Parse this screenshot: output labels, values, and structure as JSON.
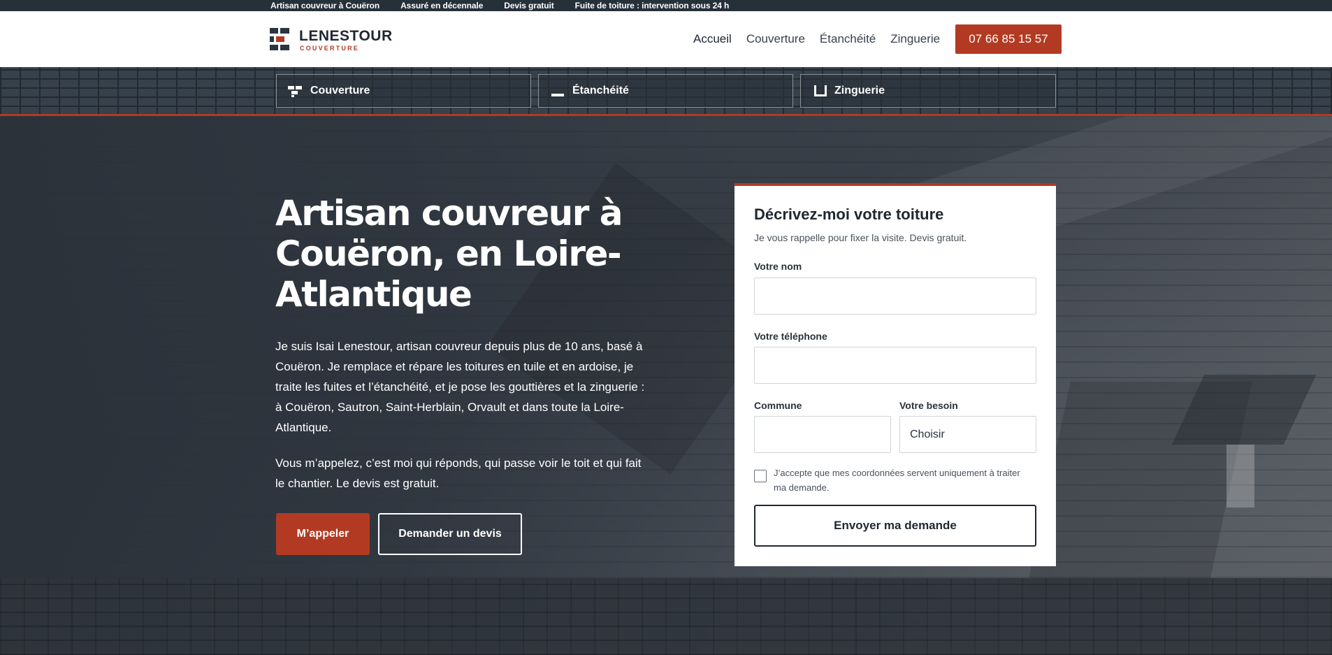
{
  "topbar": {
    "items": [
      "Artisan couvreur à Couëron",
      "Assuré en décennale",
      "Devis gratuit",
      "Fuite de toiture : intervention sous 24 h"
    ]
  },
  "logo": {
    "name": "LENESTOUR",
    "sub": "COUVERTURE"
  },
  "nav": {
    "items": [
      "Accueil",
      "Couverture",
      "Étanchéité",
      "Zinguerie"
    ],
    "phone": "07 66 85 15 57"
  },
  "services": [
    "Couverture",
    "Étanchéité",
    "Zinguerie"
  ],
  "hero": {
    "title": "Artisan couvreur à Couëron, en Loire-Atlantique",
    "p1": "Je suis Isai Lenestour, artisan couvreur depuis plus de 10 ans, basé à Couëron. Je remplace et répare les toitures en tuile et en ardoise, je traite les fuites et l’étanchéité, et je pose les gouttières et la zinguerie : à Couëron, Sautron, Saint-Herblain, Orvault et dans toute la Loire-Atlantique.",
    "p2": "Vous m’appelez, c’est moi qui réponds, qui passe voir le toit et qui fait le chantier. Le devis est gratuit.",
    "call_label": "M’appeler",
    "quote_label": "Demander un devis"
  },
  "form": {
    "title": "Décrivez-moi votre toiture",
    "subtitle": "Je vous rappelle pour fixer la visite. Devis gratuit.",
    "name_label": "Votre nom",
    "name_value": "",
    "phone_label": "Votre téléphone",
    "phone_value": "",
    "commune_label": "Commune",
    "commune_value": "",
    "need_label": "Votre besoin",
    "need_selected": "Choisir",
    "consent": "J’accepte que mes coordonnées servent uniquement à traiter ma demande.",
    "submit_label": "Envoyer ma demande"
  },
  "colors": {
    "accent": "#b23a22",
    "dark": "#263039",
    "white": "#ffffff"
  }
}
